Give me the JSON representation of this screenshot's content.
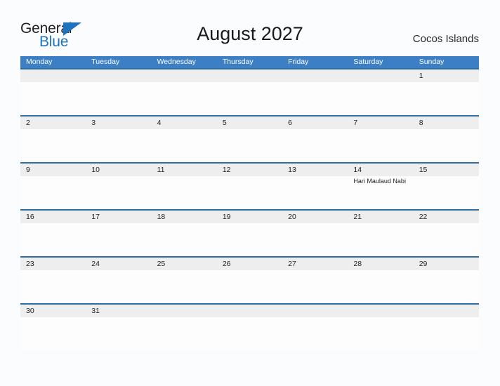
{
  "brand": {
    "name_part1": "General",
    "name_part2": "Blue",
    "triangle_icon": "triangle-icon",
    "color_dark": "#231f20",
    "color_blue": "#1e73be"
  },
  "header": {
    "title": "August 2027",
    "location": "Cocos Islands"
  },
  "colors": {
    "header_blue": "#3c7fc4",
    "row_divider_blue": "#2e6da4",
    "date_band_gray": "#eeeeee",
    "page_background": "#fbfcfd"
  },
  "calendar": {
    "weekdays": [
      "Monday",
      "Tuesday",
      "Wednesday",
      "Thursday",
      "Friday",
      "Saturday",
      "Sunday"
    ],
    "weeks": [
      {
        "days": [
          {
            "date": "",
            "event": ""
          },
          {
            "date": "",
            "event": ""
          },
          {
            "date": "",
            "event": ""
          },
          {
            "date": "",
            "event": ""
          },
          {
            "date": "",
            "event": ""
          },
          {
            "date": "",
            "event": ""
          },
          {
            "date": "1",
            "event": ""
          }
        ]
      },
      {
        "days": [
          {
            "date": "2",
            "event": ""
          },
          {
            "date": "3",
            "event": ""
          },
          {
            "date": "4",
            "event": ""
          },
          {
            "date": "5",
            "event": ""
          },
          {
            "date": "6",
            "event": ""
          },
          {
            "date": "7",
            "event": ""
          },
          {
            "date": "8",
            "event": ""
          }
        ]
      },
      {
        "days": [
          {
            "date": "9",
            "event": ""
          },
          {
            "date": "10",
            "event": ""
          },
          {
            "date": "11",
            "event": ""
          },
          {
            "date": "12",
            "event": ""
          },
          {
            "date": "13",
            "event": ""
          },
          {
            "date": "14",
            "event": "Hari Maulaud Nabi"
          },
          {
            "date": "15",
            "event": ""
          }
        ]
      },
      {
        "days": [
          {
            "date": "16",
            "event": ""
          },
          {
            "date": "17",
            "event": ""
          },
          {
            "date": "18",
            "event": ""
          },
          {
            "date": "19",
            "event": ""
          },
          {
            "date": "20",
            "event": ""
          },
          {
            "date": "21",
            "event": ""
          },
          {
            "date": "22",
            "event": ""
          }
        ]
      },
      {
        "days": [
          {
            "date": "23",
            "event": ""
          },
          {
            "date": "24",
            "event": ""
          },
          {
            "date": "25",
            "event": ""
          },
          {
            "date": "26",
            "event": ""
          },
          {
            "date": "27",
            "event": ""
          },
          {
            "date": "28",
            "event": ""
          },
          {
            "date": "29",
            "event": ""
          }
        ]
      },
      {
        "days": [
          {
            "date": "30",
            "event": ""
          },
          {
            "date": "31",
            "event": ""
          },
          {
            "date": "",
            "event": ""
          },
          {
            "date": "",
            "event": ""
          },
          {
            "date": "",
            "event": ""
          },
          {
            "date": "",
            "event": ""
          },
          {
            "date": "",
            "event": ""
          }
        ]
      }
    ]
  }
}
